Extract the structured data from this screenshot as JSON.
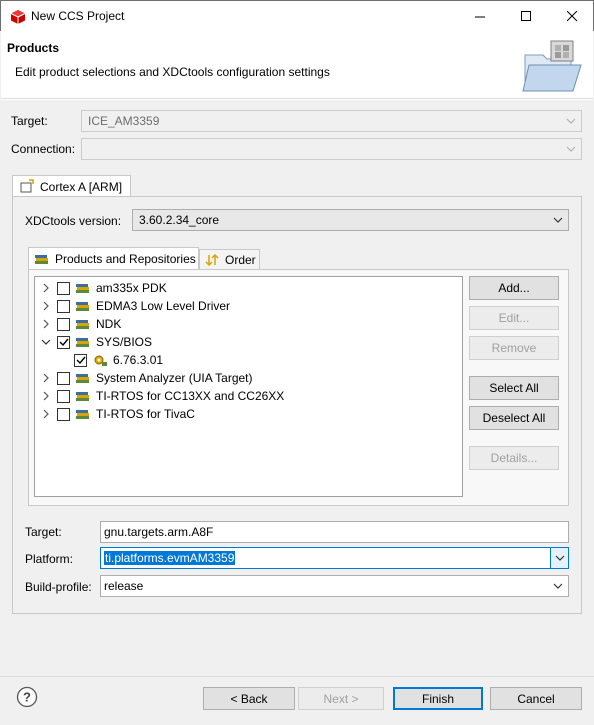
{
  "window": {
    "title": "New CCS Project",
    "controls": [
      "minimize",
      "maximize",
      "close"
    ]
  },
  "header": {
    "title": "Products",
    "description": "Edit product selections and XDCtools configuration settings"
  },
  "target_field": {
    "label": "Target:",
    "value": "ICE_AM3359",
    "enabled": false
  },
  "connection_field": {
    "label": "Connection:",
    "value": "",
    "enabled": false
  },
  "core_tab": {
    "label": "Cortex A [ARM]"
  },
  "xdctools": {
    "label": "XDCtools version:",
    "value": "3.60.2.34_core"
  },
  "inner_tabs": {
    "products": "Products and Repositories",
    "order": "Order"
  },
  "products": [
    {
      "label": "am335x PDK",
      "expanded": false,
      "checked": false
    },
    {
      "label": "EDMA3 Low Level Driver",
      "expanded": false,
      "checked": false
    },
    {
      "label": "NDK",
      "expanded": false,
      "checked": false
    },
    {
      "label": "SYS/BIOS",
      "expanded": true,
      "checked": true,
      "children": [
        {
          "label": "6.76.3.01",
          "checked": true
        }
      ]
    },
    {
      "label": "System Analyzer (UIA Target)",
      "expanded": false,
      "checked": false
    },
    {
      "label": "TI-RTOS for CC13XX and CC26XX",
      "expanded": false,
      "checked": false
    },
    {
      "label": "TI-RTOS for TivaC",
      "expanded": false,
      "checked": false
    }
  ],
  "side_buttons": {
    "add": "Add...",
    "edit": "Edit...",
    "remove": "Remove",
    "select_all": "Select All",
    "deselect_all": "Deselect All",
    "details": "Details..."
  },
  "config": {
    "target_label": "Target:",
    "target_value": "gnu.targets.arm.A8F",
    "platform_label": "Platform:",
    "platform_value": "ti.platforms.evmAM3359",
    "build_profile_label": "Build-profile:",
    "build_profile_value": "release"
  },
  "footer": {
    "help_icon": "question-icon",
    "back": "< Back",
    "next": "Next >",
    "finish": "Finish",
    "cancel": "Cancel"
  },
  "colors": {
    "accent": "#0078d7",
    "app_icon": "#cc0000"
  }
}
